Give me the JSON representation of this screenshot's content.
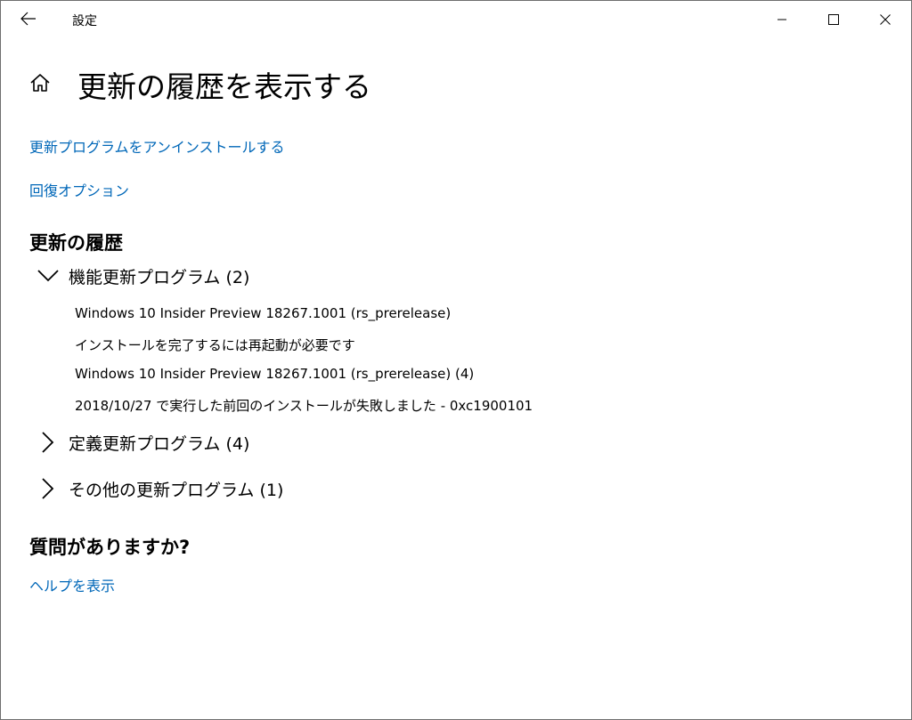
{
  "window": {
    "title": "設定",
    "back_icon": "back-arrow-icon",
    "controls": [
      "minimize-icon",
      "maximize-icon",
      "close-icon"
    ]
  },
  "page": {
    "home_icon": "home-icon",
    "title": "更新の履歴を表示する"
  },
  "links": {
    "uninstall": "更新プログラムをアンインストールする",
    "recovery": "回復オプション"
  },
  "history": {
    "heading": "更新の履歴",
    "groups": [
      {
        "label": "機能更新プログラム (2)",
        "expanded": true,
        "entries": [
          "Windows 10 Insider Preview 18267.1001 (rs_prerelease)",
          "インストールを完了するには再起動が必要です",
          "Windows 10 Insider Preview 18267.1001 (rs_prerelease) (4)",
          "2018/10/27 で実行した前回のインストールが失敗しました - 0xc1900101"
        ]
      },
      {
        "label": "定義更新プログラム (4)",
        "expanded": false
      },
      {
        "label": "その他の更新プログラム (1)",
        "expanded": false
      }
    ]
  },
  "help": {
    "heading": "質問がありますか?",
    "link": "ヘルプを表示"
  },
  "colors": {
    "link": "#0067b8",
    "text": "#000000",
    "background": "#ffffff"
  }
}
